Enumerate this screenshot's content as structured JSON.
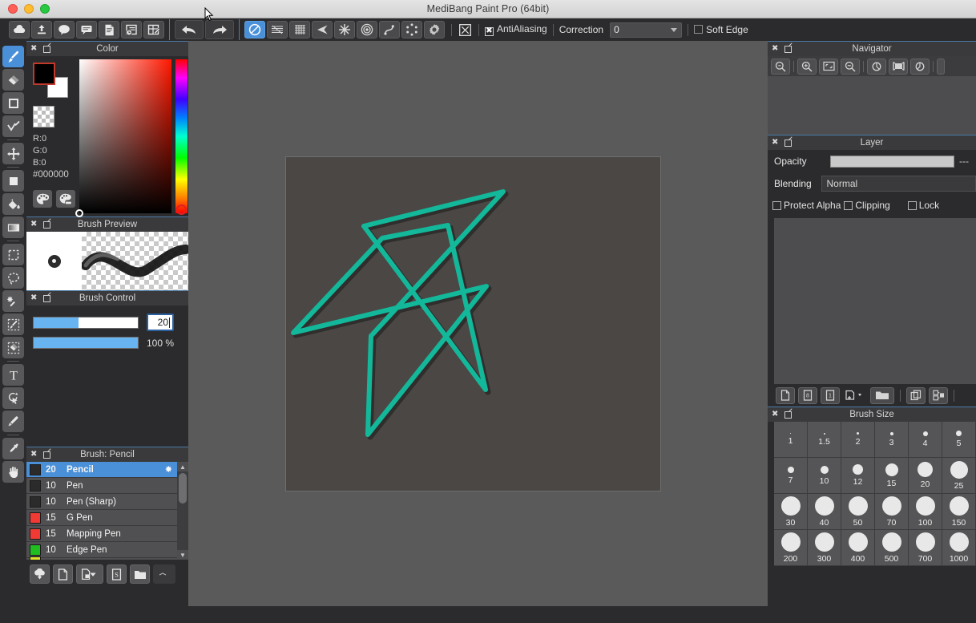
{
  "window": {
    "title": "MediBang Paint Pro (64bit)",
    "traffic_lights": [
      "close-red",
      "minimize-yellow",
      "maximize-green"
    ]
  },
  "toolbar": {
    "left_buttons": [
      {
        "name": "cloud-icon",
        "label": "Cloud"
      },
      {
        "name": "upload-icon",
        "label": "Upload"
      },
      {
        "name": "comment-balloon-icon",
        "label": "Comment"
      },
      {
        "name": "speech-bubble-icon",
        "label": "Speech Bubble"
      },
      {
        "name": "document-icon",
        "label": "Document"
      },
      {
        "name": "timeline-icon",
        "label": "Timeline"
      },
      {
        "name": "grid-edit-icon",
        "label": "Grid Edit"
      }
    ],
    "history": [
      {
        "name": "undo-icon",
        "label": "Undo"
      },
      {
        "name": "redo-icon",
        "label": "Redo"
      }
    ],
    "options": [
      {
        "name": "no-correction-icon",
        "label": "No Correction",
        "active": true
      },
      {
        "name": "hatching-icon",
        "label": "Hatching",
        "active": false
      },
      {
        "name": "grid-icon",
        "label": "Grid",
        "active": false
      },
      {
        "name": "parallel-lines-icon",
        "label": "Parallel Lines",
        "active": false
      },
      {
        "name": "radial-icon",
        "label": "Radial",
        "active": false
      },
      {
        "name": "concentric-circles-icon",
        "label": "Concentric Circles",
        "active": false
      },
      {
        "name": "curve-icon",
        "label": "Curve",
        "active": false
      },
      {
        "name": "polygon-icon",
        "label": "Polygon",
        "active": false
      },
      {
        "name": "gear-icon",
        "label": "Settings",
        "active": false
      }
    ],
    "snap_off": {
      "name": "snap-off-icon",
      "label": "Snap Off"
    },
    "antialiasing": {
      "label": "AntiAliasing",
      "checked": true,
      "mark": "✖"
    },
    "correction": {
      "label": "Correction",
      "value": "0"
    },
    "soft_edge": {
      "label": "Soft Edge",
      "checked": false
    }
  },
  "tool_rail": [
    {
      "name": "brush-tool",
      "label": "Brush",
      "active": true
    },
    {
      "name": "eraser-tool",
      "label": "Eraser",
      "active": false
    },
    {
      "name": "shape-tool",
      "label": "Shape",
      "active": false
    },
    {
      "name": "line-tool",
      "label": "Line / Curve",
      "active": false
    },
    {
      "name": "move-tool",
      "label": "Move",
      "active": false
    },
    {
      "name": "fill-rect-tool",
      "label": "Fill Rect",
      "active": false
    },
    {
      "name": "bucket-tool",
      "label": "Bucket",
      "active": false
    },
    {
      "name": "gradient-tool",
      "label": "Gradient",
      "active": false
    },
    {
      "name": "select-rect-tool",
      "label": "Rectangle Select",
      "active": false
    },
    {
      "name": "lasso-tool",
      "label": "Lasso Select",
      "active": false
    },
    {
      "name": "magic-wand-tool",
      "label": "Magic Wand",
      "active": false
    },
    {
      "name": "select-brush-tool",
      "label": "Select Brush",
      "active": false
    },
    {
      "name": "select-eraser-tool",
      "label": "Select Eraser",
      "active": false
    },
    {
      "name": "text-tool",
      "label": "Text",
      "active": false
    },
    {
      "name": "operation-tool",
      "label": "Operation",
      "active": false
    },
    {
      "name": "hilighter-tool",
      "label": "Hilighter",
      "active": false
    },
    {
      "name": "eyedropper-tool",
      "label": "Eyedropper",
      "active": false
    },
    {
      "name": "hand-tool",
      "label": "Hand",
      "active": false
    }
  ],
  "color_panel": {
    "title": "Color",
    "r_label": "R:0",
    "g_label": "G:0",
    "b_label": "B:0",
    "hex": "#000000",
    "foreground": "#000000",
    "background": "#ffffff",
    "buttons": [
      {
        "name": "palette-icon",
        "label": "Palette"
      },
      {
        "name": "palette-edit-icon",
        "label": "Palette Edit"
      }
    ]
  },
  "brush_preview": {
    "title": "Brush Preview"
  },
  "brush_control": {
    "title": "Brush Control",
    "size_value": "20",
    "size_percent": 43,
    "opacity_label": "100 %",
    "opacity_percent": 100
  },
  "brush_list": {
    "title": "Brush: Pencil",
    "items": [
      {
        "size": "20",
        "name": "Pencil",
        "color": "#2b2b2b",
        "selected": true
      },
      {
        "size": "10",
        "name": "Pen",
        "color": "#2b2b2b",
        "selected": false
      },
      {
        "size": "10",
        "name": "Pen (Sharp)",
        "color": "#2b2b2b",
        "selected": false
      },
      {
        "size": "15",
        "name": "G Pen",
        "color": "#f23a34",
        "selected": false
      },
      {
        "size": "15",
        "name": "Mapping Pen",
        "color": "#f23a34",
        "selected": false
      },
      {
        "size": "10",
        "name": "Edge Pen",
        "color": "#1fbd1f",
        "selected": false
      }
    ],
    "partial_next_color": "#e0e02a",
    "footer_buttons": [
      {
        "name": "download-brush-icon",
        "label": "Download Brush"
      },
      {
        "name": "new-brush-icon",
        "label": "New Brush"
      },
      {
        "name": "duplicate-brush-icon",
        "label": "Duplicate Brush"
      },
      {
        "name": "script-brush-icon",
        "label": "Script Brush"
      },
      {
        "name": "brush-folder-icon",
        "label": "Brush Folder"
      }
    ]
  },
  "navigator": {
    "title": "Navigator",
    "buttons": [
      {
        "name": "zoom-actual-icon",
        "label": "Actual Size"
      },
      {
        "name": "zoom-in-icon",
        "label": "Zoom In"
      },
      {
        "name": "fit-screen-icon",
        "label": "Fit to Screen"
      },
      {
        "name": "zoom-out-icon",
        "label": "Zoom Out"
      },
      {
        "name": "rotate-left-icon",
        "label": "Rotate Left"
      },
      {
        "name": "flip-horizontal-icon",
        "label": "Flip Horizontal"
      },
      {
        "name": "rotate-right-icon",
        "label": "Rotate Right"
      }
    ]
  },
  "layer_panel": {
    "title": "Layer",
    "opacity_label": "Opacity",
    "opacity_value": "---",
    "blending_label": "Blending",
    "blending_value": "Normal",
    "checkboxes": [
      {
        "label": "Protect Alpha",
        "checked": false
      },
      {
        "label": "Clipping",
        "checked": false
      },
      {
        "label": "Lock",
        "checked": false
      }
    ],
    "footer_buttons": [
      {
        "name": "new-layer-icon",
        "label": "New Layer"
      },
      {
        "name": "new-8bit-layer-icon",
        "label": "New 8bit Layer"
      },
      {
        "name": "new-1bit-layer-icon",
        "label": "New 1bit Layer"
      },
      {
        "name": "add-layer-dropdown-icon",
        "label": "Add Layer"
      },
      {
        "name": "new-folder-icon",
        "label": "New Folder"
      },
      {
        "name": "duplicate-layer-icon",
        "label": "Duplicate Layer"
      },
      {
        "name": "merge-layer-icon",
        "label": "Merge Layer"
      }
    ]
  },
  "brush_size_panel": {
    "title": "Brush Size",
    "sizes": [
      {
        "label": "1",
        "dot": 1.5
      },
      {
        "label": "1.5",
        "dot": 2
      },
      {
        "label": "2",
        "dot": 3
      },
      {
        "label": "3",
        "dot": 4
      },
      {
        "label": "4",
        "dot": 6
      },
      {
        "label": "5",
        "dot": 7
      },
      {
        "label": "7",
        "dot": 8
      },
      {
        "label": "10",
        "dot": 10
      },
      {
        "label": "12",
        "dot": 13
      },
      {
        "label": "15",
        "dot": 16
      },
      {
        "label": "20",
        "dot": 19
      },
      {
        "label": "25",
        "dot": 22
      },
      {
        "label": "30",
        "dot": 24
      },
      {
        "label": "40",
        "dot": 24
      },
      {
        "label": "50",
        "dot": 24
      },
      {
        "label": "70",
        "dot": 24
      },
      {
        "label": "100",
        "dot": 24
      },
      {
        "label": "150",
        "dot": 24
      },
      {
        "label": "200",
        "dot": 24
      },
      {
        "label": "300",
        "dot": 24
      },
      {
        "label": "400",
        "dot": 24
      },
      {
        "label": "500",
        "dot": 24
      },
      {
        "label": "700",
        "dot": 24
      },
      {
        "label": "1000",
        "dot": 24
      }
    ]
  },
  "canvas": {
    "paper_color": "#4a4745",
    "stroke_color": "#13b89a",
    "stroke_width": 6,
    "polyline_points": "106 223, 271 43, 97 86, 249 290, 202 85, 120 101, 9 219, 250 161, 102 346, 106 223"
  }
}
